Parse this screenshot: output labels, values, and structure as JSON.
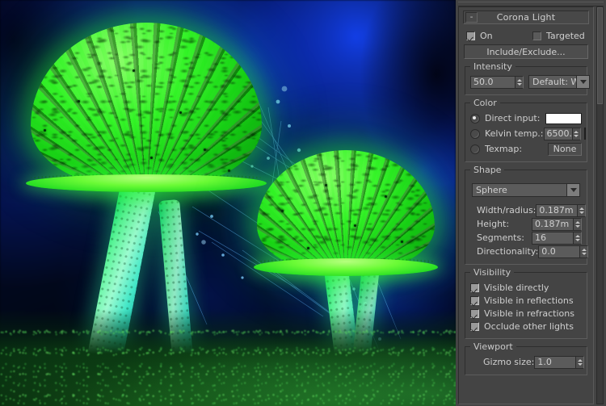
{
  "viewport": {
    "name": "render-preview",
    "description": "Two glowing green bioluminescent mushrooms on dark blue background with moss"
  },
  "panel": {
    "rollout": {
      "title": "Corona Light",
      "collapse_label": "-"
    },
    "on": {
      "label": "On",
      "checked": true
    },
    "targeted": {
      "label": "Targeted",
      "checked": false
    },
    "include_exclude": {
      "label": "Include/Exclude..."
    },
    "intensity": {
      "group_label": "Intensity",
      "value": "50.0",
      "units": "Default: W"
    },
    "color": {
      "group_label": "Color",
      "direct_input": {
        "label": "Direct input:",
        "selected": true,
        "swatch": "#ffffff"
      },
      "kelvin": {
        "label": "Kelvin temp.:",
        "selected": false,
        "value": "6500.0",
        "swatch": "#ffffff"
      },
      "texmap": {
        "label": "Texmap:",
        "selected": false,
        "value": "None"
      }
    },
    "shape": {
      "group_label": "Shape",
      "type": "Sphere",
      "fields": [
        {
          "label": "Width/radius:",
          "value": "0.187m"
        },
        {
          "label": "Height:",
          "value": "0.187m"
        },
        {
          "label": "Segments:",
          "value": "16"
        },
        {
          "label": "Directionality:",
          "value": "0.0"
        }
      ]
    },
    "visibility": {
      "group_label": "Visibility",
      "items": [
        {
          "label": "Visible directly",
          "checked": true
        },
        {
          "label": "Visible in reflections",
          "checked": true
        },
        {
          "label": "Visible in refractions",
          "checked": true
        },
        {
          "label": "Occlude other lights",
          "checked": true
        }
      ]
    },
    "viewport_group": {
      "group_label": "Viewport",
      "gizmo_label": "Gizmo size:",
      "gizmo_value": "1.0"
    }
  },
  "colors": {
    "panel_bg": "#444444",
    "field_bg": "#5b5b5b",
    "text": "#cfcfcf",
    "glow_green": "#2ae024",
    "bg_blue": "#0b2ec8"
  }
}
